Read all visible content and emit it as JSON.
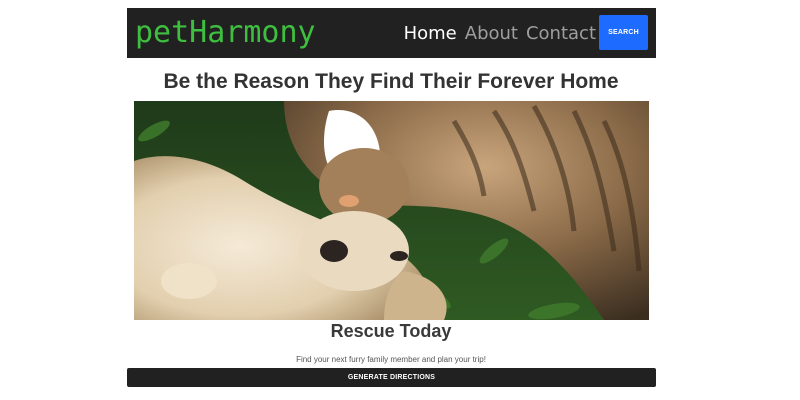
{
  "header": {
    "brand": "petHarmony",
    "nav": [
      {
        "label": "Home",
        "active": true
      },
      {
        "label": "About",
        "active": false
      },
      {
        "label": "Contact",
        "active": false
      }
    ],
    "search_label": "SEARCH"
  },
  "main": {
    "headline": "Be the Reason They Find Their Forever Home",
    "hero_image": "cat-and-dog-cuddling-photo",
    "subheading": "Rescue Today",
    "tagline": "Find your next furry family member and plan your trip!",
    "cta_label": "GENERATE DIRECTIONS"
  },
  "colors": {
    "navbar_bg": "#212121",
    "brand_green": "#3fbf3f",
    "search_blue": "#1e6bff",
    "nav_inactive": "#9e9e9e",
    "nav_active": "#ffffff"
  }
}
